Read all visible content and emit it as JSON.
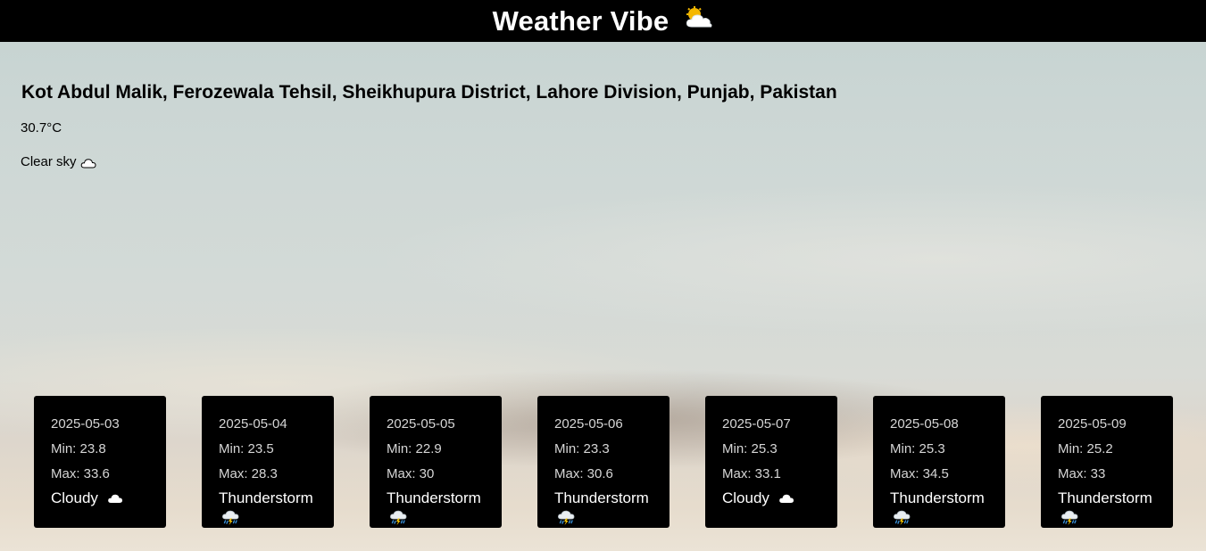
{
  "header": {
    "title": "Weather Vibe",
    "icon": "sun-behind-cloud-icon"
  },
  "current": {
    "location": "Kot Abdul Malik, Ferozewala Tehsil, Sheikhupura District, Lahore Division, Punjab, Pakistan",
    "temperature": "30.7°C",
    "description": "Clear sky",
    "icon": "cloud-icon"
  },
  "forecast": [
    {
      "date": "2025-05-03",
      "min": "Min: 23.8",
      "max": "Max: 33.6",
      "desc": "Cloudy",
      "icon": "cloud-icon"
    },
    {
      "date": "2025-05-04",
      "min": "Min: 23.5",
      "max": "Max: 28.3",
      "desc": "Thunderstorm",
      "icon": "thunderstorm-icon"
    },
    {
      "date": "2025-05-05",
      "min": "Min: 22.9",
      "max": "Max: 30",
      "desc": "Thunderstorm",
      "icon": "thunderstorm-icon"
    },
    {
      "date": "2025-05-06",
      "min": "Min: 23.3",
      "max": "Max: 30.6",
      "desc": "Thunderstorm",
      "icon": "thunderstorm-icon"
    },
    {
      "date": "2025-05-07",
      "min": "Min: 25.3",
      "max": "Max: 33.1",
      "desc": "Cloudy",
      "icon": "cloud-icon"
    },
    {
      "date": "2025-05-08",
      "min": "Min: 25.3",
      "max": "Max: 34.5",
      "desc": "Thunderstorm",
      "icon": "thunderstorm-icon"
    },
    {
      "date": "2025-05-09",
      "min": "Min: 25.2",
      "max": "Max: 33",
      "desc": "Thunderstorm",
      "icon": "thunderstorm-icon"
    }
  ]
}
